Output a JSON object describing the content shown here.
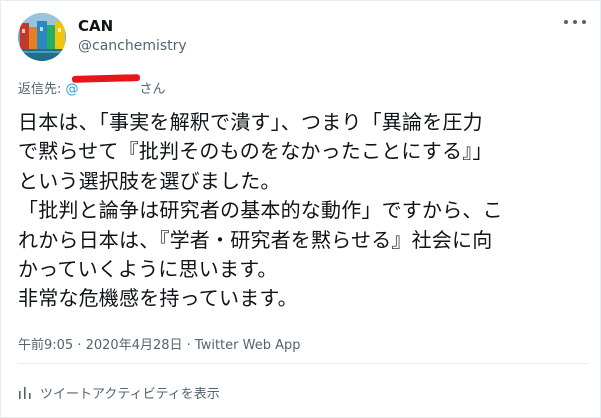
{
  "user": {
    "display_name": "CAN",
    "handle": "@canchemistry"
  },
  "reply": {
    "prefix": "返信先: ",
    "mention": "@",
    "suffix": "さん"
  },
  "tweet": {
    "lines": [
      "日本は、「事実を解釈で潰す」、つまり「異論を圧力",
      "で黙らせて『批判そのものをなかったことにする』」",
      "という選択肢を選びました。",
      "「批判と論争は研究者の基本的な動作」ですから、こ",
      "れから日本は、『学者・研究者を黙らせる』社会に向",
      "かっていくように思います。",
      "非常な危機感を持っています。"
    ]
  },
  "meta": {
    "time": "午前9:05",
    "separator1": " · ",
    "date": "2020年4月28日",
    "separator2": " · ",
    "source": "Twitter Web App"
  },
  "activity": {
    "label": "ツイートアクティビティを表示",
    "icon": "bar-chart-icon"
  },
  "more_icon": "more-icon",
  "colors": {
    "text_primary": "#0f1419",
    "text_secondary": "#536471",
    "link": "#1d9bf0",
    "redaction": "#e8151b",
    "divider": "#e6ecf0"
  }
}
